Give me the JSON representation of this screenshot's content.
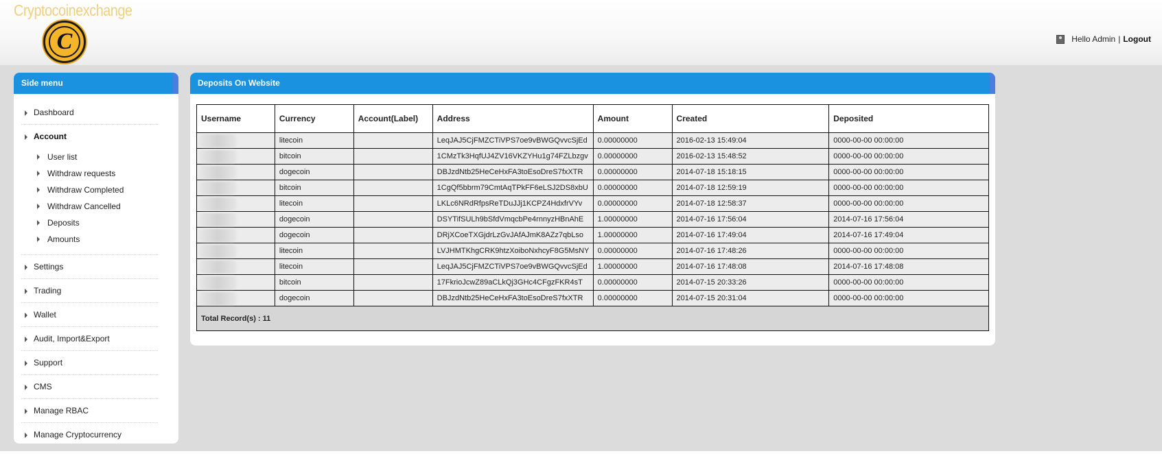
{
  "header": {
    "brand": "Cryptocoinexchange",
    "logo_letter": "C",
    "greeting": "Hello Admin",
    "separator": "|",
    "logout": "Logout"
  },
  "sidebar": {
    "title": "Side menu",
    "items": [
      {
        "label": "Dashboard"
      },
      {
        "label": "Account",
        "children": [
          "User list",
          "Withdraw requests",
          "Withdraw Completed",
          "Withdraw Cancelled",
          "Deposits",
          "Amounts"
        ]
      },
      {
        "label": "Settings"
      },
      {
        "label": "Trading"
      },
      {
        "label": "Wallet"
      },
      {
        "label": "Audit, Import&Export"
      },
      {
        "label": "Support"
      },
      {
        "label": "CMS"
      },
      {
        "label": "Manage RBAC"
      },
      {
        "label": "Manage Cryptocurrency"
      }
    ]
  },
  "main": {
    "title": "Deposits On Website",
    "columns": [
      "Username",
      "Currency",
      "Account(Label)",
      "Address",
      "Amount",
      "Created",
      "Deposited"
    ],
    "rows": [
      [
        "",
        "litecoin",
        "",
        "LeqJAJ5CjFMZCTiVPS7oe9vBWGQvvcSjEd",
        "0.00000000",
        "2016-02-13 15:49:04",
        "0000-00-00 00:00:00"
      ],
      [
        "",
        "bitcoin",
        "",
        "1CMzTk3HqfUJ4ZV16VKZYHu1g74FZLbzgv",
        "0.00000000",
        "2016-02-13 15:48:52",
        "0000-00-00 00:00:00"
      ],
      [
        "",
        "dogecoin",
        "",
        "DBJzdNtb25HeCeHxFA3toEsoDreS7fxXTR",
        "0.00000000",
        "2014-07-18 15:18:15",
        "0000-00-00 00:00:00"
      ],
      [
        "",
        "bitcoin",
        "",
        "1CgQf5bbrm79CmtAqTPkFF6eLSJ2DS8xbU",
        "0.00000000",
        "2014-07-18 12:59:19",
        "0000-00-00 00:00:00"
      ],
      [
        "",
        "litecoin",
        "",
        "LKLc6NRdRfpsReTDuJJj1KCPZ4HdxfrVYv",
        "0.00000000",
        "2014-07-18 12:58:37",
        "0000-00-00 00:00:00"
      ],
      [
        "",
        "dogecoin",
        "",
        "DSYTifSULh9bSfdVmqcbPe4rnnyzHBnAhE",
        "1.00000000",
        "2014-07-16 17:56:04",
        "2014-07-16 17:56:04"
      ],
      [
        "",
        "dogecoin",
        "",
        "DRjXCoeTXGjdrLzGvJAfAJmK8AZz7qbLso",
        "1.00000000",
        "2014-07-16 17:49:04",
        "2014-07-16 17:49:04"
      ],
      [
        "",
        "litecoin",
        "",
        "LVJHMTKhgCRK9htzXoiboNxhcyF8G5MsNY",
        "0.00000000",
        "2014-07-16 17:48:26",
        "0000-00-00 00:00:00"
      ],
      [
        "",
        "litecoin",
        "",
        "LeqJAJ5CjFMZCTiVPS7oe9vBWGQvvcSjEd",
        "1.00000000",
        "2014-07-16 17:48:08",
        "2014-07-16 17:48:08"
      ],
      [
        "",
        "bitcoin",
        "",
        "17FkrioJcwZ89aCLkQj3GHc4CFgzFKR4sT",
        "0.00000000",
        "2014-07-15 20:33:26",
        "0000-00-00 00:00:00"
      ],
      [
        "",
        "dogecoin",
        "",
        "DBJzdNtb25HeCeHxFA3toEsoDreS7fxXTR",
        "0.00000000",
        "2014-07-15 20:31:04",
        "0000-00-00 00:00:00"
      ]
    ],
    "total_label": "Total Record(s) : 11"
  }
}
